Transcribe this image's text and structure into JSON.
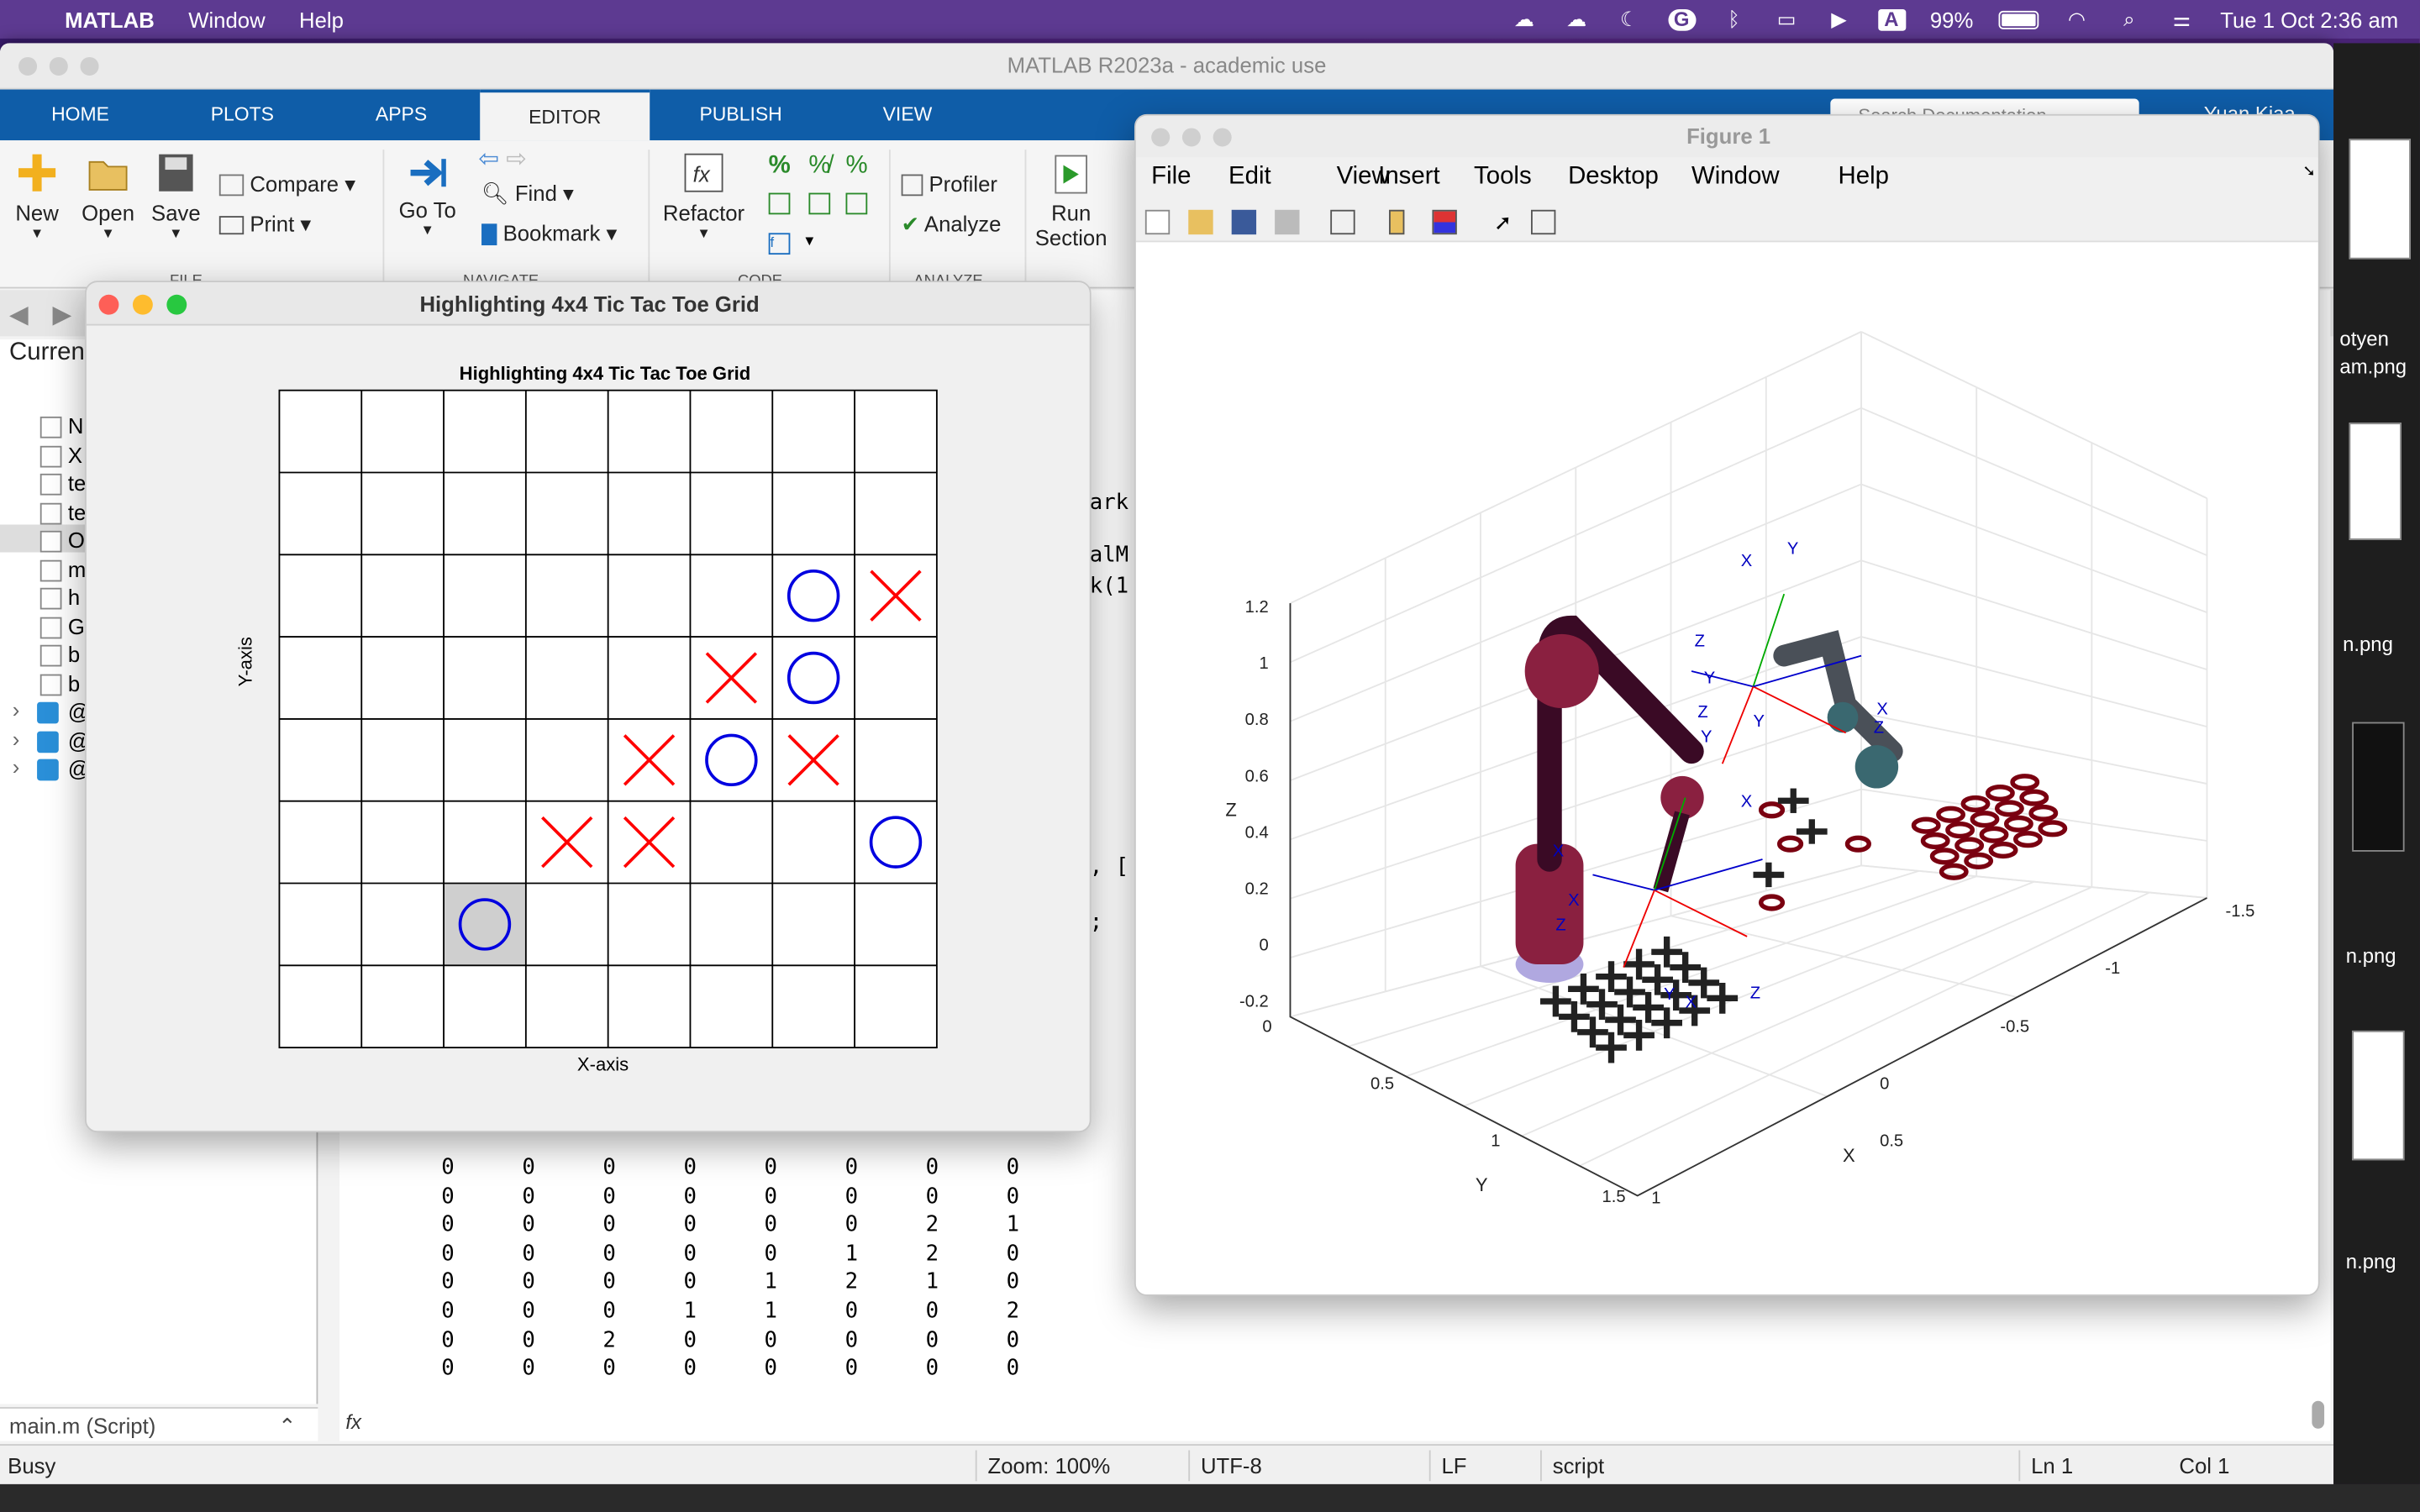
{
  "menubar": {
    "app": "MATLAB",
    "items": [
      "Window",
      "Help"
    ],
    "battery": "99%",
    "datetime": "Tue 1 Oct  2:36 am"
  },
  "matlab": {
    "title": "MATLAB R2023a - academic use",
    "tabs": [
      "HOME",
      "PLOTS",
      "APPS",
      "EDITOR",
      "PUBLISH",
      "VIEW"
    ],
    "ribbon": {
      "new": "New",
      "open": "Open",
      "save": "Save",
      "compare": "Compare",
      "print": "Print",
      "goto": "Go To",
      "find": "Find",
      "bookmark": "Bookmark",
      "refactor": "Refactor",
      "profiler": "Profiler",
      "analyze": "Analyze",
      "run_section_1": "Run",
      "run_section_2": "Section",
      "group_file": "FILE",
      "group_navigate": "NAVIGATE",
      "group_code": "CODE",
      "group_analyze": "ANALYZE"
    },
    "search_placeholder": "Search Documentation",
    "user": "Yuan Kiaa",
    "current_folder_label": "Curren",
    "folder_items": [
      "N",
      "X",
      "te",
      "te",
      "O",
      "m",
      "h",
      "G",
      "b",
      "b",
      "@",
      "@",
      "@"
    ],
    "left_footer": "main.m  (Script)",
    "editor_fragments": [
      "ark",
      "alM",
      "k(1",
      ", [",
      ";"
    ],
    "matrix": [
      [
        0,
        0,
        0,
        0,
        0,
        0,
        0,
        0
      ],
      [
        0,
        0,
        0,
        0,
        0,
        0,
        0,
        0
      ],
      [
        0,
        0,
        0,
        0,
        0,
        0,
        2,
        1
      ],
      [
        0,
        0,
        0,
        0,
        0,
        1,
        2,
        0
      ],
      [
        0,
        0,
        0,
        0,
        1,
        2,
        1,
        0
      ],
      [
        0,
        0,
        0,
        1,
        1,
        0,
        0,
        2
      ],
      [
        0,
        0,
        2,
        0,
        0,
        0,
        0,
        0
      ],
      [
        0,
        0,
        0,
        0,
        0,
        0,
        0,
        0
      ]
    ],
    "fx": "fx",
    "status": {
      "left": "Busy",
      "zoom": "Zoom: 100%",
      "encoding": "UTF-8",
      "eol": "LF",
      "type": "script",
      "ln": "Ln   1",
      "col": "Col   1"
    }
  },
  "ttt": {
    "window_title": "Highlighting 4x4 Tic Tac Toe Grid",
    "plot_title": "Highlighting 4x4 Tic Tac Toe Grid",
    "xlabel": "X-axis",
    "ylabel": "Y-axis",
    "board": [
      [
        "",
        "",
        "",
        "",
        "",
        "",
        "",
        ""
      ],
      [
        "",
        "",
        "",
        "",
        "",
        "",
        "",
        ""
      ],
      [
        "",
        "",
        "",
        "",
        "",
        "",
        "O",
        "X"
      ],
      [
        "",
        "",
        "",
        "",
        "",
        "X",
        "O",
        ""
      ],
      [
        "",
        "",
        "",
        "",
        "X",
        "O",
        "X",
        ""
      ],
      [
        "",
        "",
        "",
        "X",
        "X",
        "",
        "",
        "O"
      ],
      [
        "",
        "",
        "O",
        "",
        "",
        "",
        "",
        ""
      ],
      [
        "",
        "",
        "",
        "",
        "",
        "",
        "",
        ""
      ]
    ],
    "highlight": {
      "row": 6,
      "col": 2
    },
    "colors": {
      "x": "#ff0000",
      "o": "#0000e0",
      "highlight": "#cfcfcf"
    }
  },
  "figure": {
    "title": "Figure 1",
    "menu": [
      "File",
      "Edit",
      "View",
      "Insert",
      "Tools",
      "Desktop",
      "Window",
      "Help"
    ],
    "axes": {
      "z_ticks": [
        "1.2",
        "1",
        "0.8",
        "0.6",
        "0.4",
        "0.2",
        "0",
        "-0.2"
      ],
      "y_ticks": [
        "0",
        "0.5",
        "1",
        "1.5"
      ],
      "x_ticks": [
        "1",
        "0.5",
        "0",
        "-0.5",
        "-1",
        "-1.5"
      ],
      "zlabel": "Z",
      "ylabel": "Y",
      "xlabel": "X"
    },
    "frame_labels": [
      "X",
      "Y",
      "Z",
      "Y",
      "Z",
      "Y",
      "X",
      "Z",
      "X",
      "X",
      "Z",
      "X",
      "Y",
      "X",
      "Z",
      "Y"
    ]
  },
  "right_strip": [
    "otyen",
    "am.png",
    "n.png",
    "n.png",
    "n.png"
  ]
}
